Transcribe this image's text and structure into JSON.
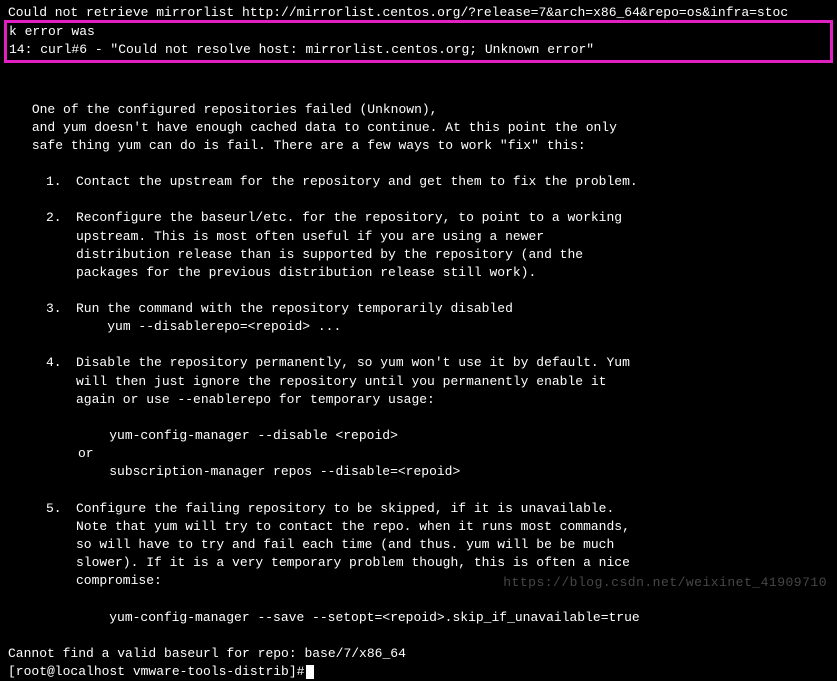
{
  "error_top": {
    "line1": "Could not retrieve mirrorlist http://mirrorlist.centos.org/?release=7&arch=x86_64&repo=os&infra=stoc",
    "line2": "k error was",
    "line3": "14: curl#6 - \"Could not resolve host: mirrorlist.centos.org; Unknown error\""
  },
  "intro": {
    "l1": " One of the configured repositories failed (Unknown),",
    "l2": " and yum doesn't have enough cached data to continue. At this point the only",
    "l3": " safe thing yum can do is fail. There are a few ways to work \"fix\" this:"
  },
  "items": [
    {
      "num": "1.",
      "body": [
        "Contact the upstream for the repository and get them to fix the problem."
      ]
    },
    {
      "num": "2.",
      "body": [
        "Reconfigure the baseurl/etc. for the repository, to point to a working",
        "upstream. This is most often useful if you are using a newer",
        "distribution release than is supported by the repository (and the",
        "packages for the previous distribution release still work)."
      ]
    },
    {
      "num": "3.",
      "body": [
        "Run the command with the repository temporarily disabled"
      ],
      "cmd": [
        "    yum --disablerepo=<repoid> ..."
      ]
    },
    {
      "num": "4.",
      "body": [
        "Disable the repository permanently, so yum won't use it by default. Yum",
        "will then just ignore the repository until you permanently enable it",
        "again or use --enablerepo for temporary usage:"
      ],
      "cmd": [
        "    yum-config-manager --disable <repoid>",
        "or",
        "    subscription-manager repos --disable=<repoid>"
      ]
    },
    {
      "num": "5.",
      "body": [
        "Configure the failing repository to be skipped, if it is unavailable.",
        "Note that yum will try to contact the repo. when it runs most commands,",
        "so will have to try and fail each time (and thus. yum will be be much",
        "slower). If it is a very temporary problem though, this is often a nice",
        "compromise:"
      ],
      "cmd": [
        "    yum-config-manager --save --setopt=<repoid>.skip_if_unavailable=true"
      ]
    }
  ],
  "footer": {
    "l1": "Cannot find a valid baseurl for repo: base/7/x86_64",
    "l2": "[root@localhost vmware-tools-distrib]#"
  },
  "watermark": "https://blog.csdn.net/weixinet_41909710"
}
